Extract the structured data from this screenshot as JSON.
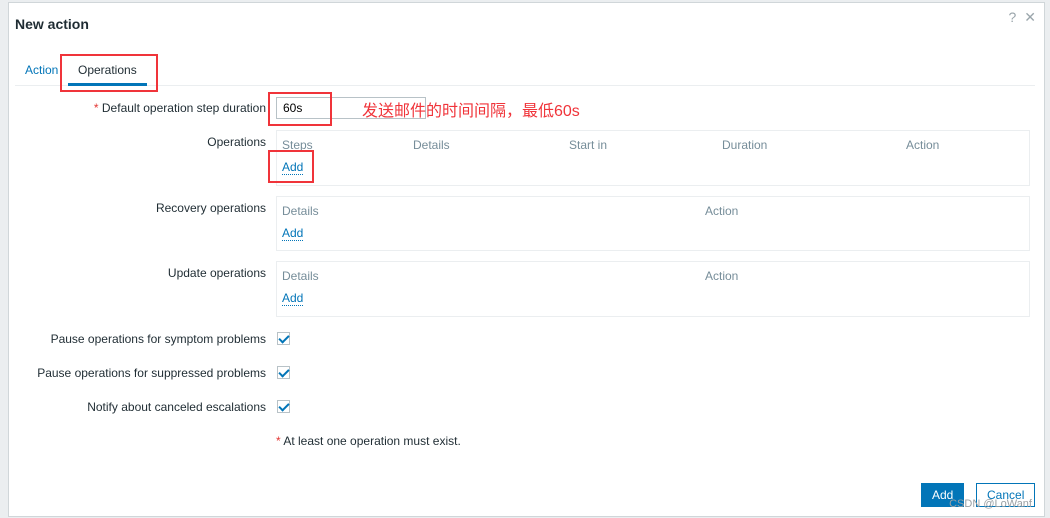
{
  "dialog": {
    "title": "New action",
    "help_icon": "question-icon",
    "close_icon": "close-icon"
  },
  "tabs": [
    {
      "label": "Action"
    },
    {
      "label": "Operations"
    }
  ],
  "form": {
    "step_duration": {
      "required": "*",
      "label": "Default operation step duration",
      "value": "60s"
    },
    "annotation": "发送邮件的时间间隔，最低60s",
    "operations": {
      "label": "Operations",
      "headers": [
        "Steps",
        "Details",
        "Start in",
        "Duration",
        "Action"
      ],
      "add": "Add"
    },
    "recovery": {
      "label": "Recovery operations",
      "headers": [
        "Details",
        "Action"
      ],
      "add": "Add"
    },
    "update": {
      "label": "Update operations",
      "headers": [
        "Details",
        "Action"
      ],
      "add": "Add"
    },
    "checkboxes": [
      {
        "label": "Pause operations for symptom problems",
        "checked": true
      },
      {
        "label": "Pause operations for suppressed problems",
        "checked": true
      },
      {
        "label": "Notify about canceled escalations",
        "checked": true
      }
    ],
    "warning": {
      "required": "*",
      "text": " At least one operation must exist."
    }
  },
  "footer": {
    "add": "Add",
    "cancel": "Cancel"
  },
  "watermark": "CSDN @LoWanf",
  "colors": {
    "accent": "#0275b8",
    "annotation": "#f0343a"
  }
}
